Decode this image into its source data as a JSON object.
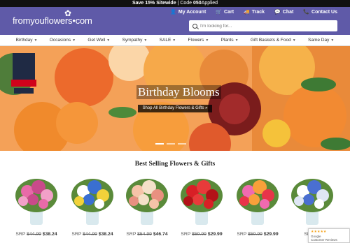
{
  "promo": {
    "bold": "Save 15% Sitewide",
    "code_text": " | Code ",
    "code": "050",
    "applied": "Applied"
  },
  "header": {
    "logo": "fromyouflowers•com",
    "links": [
      {
        "icon": "user-icon",
        "label": "My Account"
      },
      {
        "icon": "cart-icon",
        "label": "Cart"
      },
      {
        "icon": "truck-icon",
        "label": "Track"
      },
      {
        "icon": "chat-icon",
        "label": "Chat"
      },
      {
        "icon": "phone-icon",
        "label": "Contact Us"
      }
    ],
    "search_placeholder": "I'm looking for..."
  },
  "nav": [
    "Birthday",
    "Occasions",
    "Get Well",
    "Sympathy",
    "SALE",
    "Flowers",
    "Plants",
    "Gift Baskets & Food",
    "Same Day"
  ],
  "hero": {
    "title": "Birthday Blooms",
    "cta": "Shop All Birthday Flowers & Gifts »",
    "badge_top": "AMERICA'S BEST",
    "badge_main": "ONLINE SHOPS",
    "badge_year": "2024",
    "badge_brand": "Newsweek",
    "badge_sub": "statista"
  },
  "section_title": "Best Selling Flowers & Gifts",
  "products": [
    {
      "was": "$44.99",
      "now": "$38.24",
      "colors": [
        "#e86aa8",
        "#c94a8a",
        "#f2a0c8"
      ]
    },
    {
      "was": "$44.99",
      "now": "$38.24",
      "colors": [
        "#ffffff",
        "#3a6fd1",
        "#f2d23a"
      ]
    },
    {
      "was": "$54.99",
      "now": "$46.74",
      "colors": [
        "#f6c3a8",
        "#f4e0c8",
        "#e89080"
      ]
    },
    {
      "was": "$59.99",
      "now": "$29.99",
      "colors": [
        "#d81f26",
        "#e83a3a",
        "#b31218"
      ]
    },
    {
      "was": "$59.99",
      "now": "$29.99",
      "colors": [
        "#f06ab0",
        "#f9a03a",
        "#e8344a"
      ]
    },
    {
      "was": "$4",
      "now": "",
      "colors": [
        "#ffffff",
        "#4a6fd1",
        "#dfe6f5"
      ]
    }
  ],
  "price_prefix": "SRP ",
  "google": {
    "stars": "★★★★★",
    "line1": "Google",
    "line2": "Customer Reviews"
  }
}
